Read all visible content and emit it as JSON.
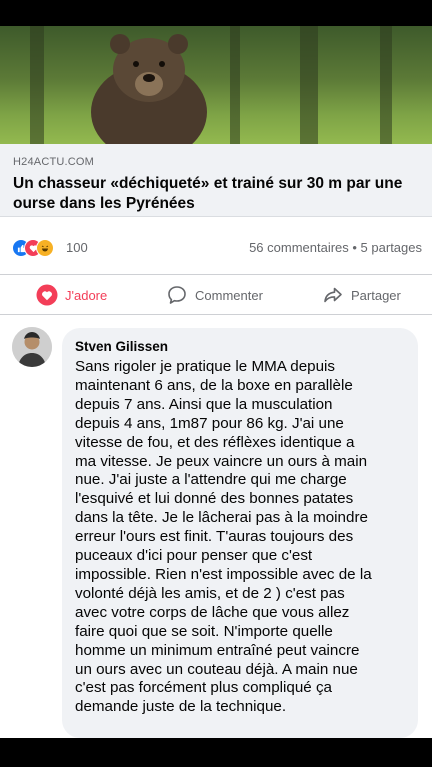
{
  "link_preview": {
    "image_alt_icon": "bear-photo",
    "domain": "H24ACTU.COM",
    "headline": "Un chasseur «déchiqueté» et trainé sur 30 m par une ourse dans les Pyrénées"
  },
  "reactions": {
    "icons": [
      "like-icon",
      "love-icon",
      "haha-icon"
    ],
    "count": "100",
    "comments_shares": "56 commentaires • 5 partages"
  },
  "actions": {
    "love_label": "J'adore",
    "comment_label": "Commenter",
    "share_label": "Partager"
  },
  "comment": {
    "author": "Stven Gilissen",
    "text": "Sans rigoler je pratique le MMA depuis\nmaintenant 6 ans, de la boxe en parallèle\ndepuis 7 ans. Ainsi que la musculation\ndepuis 4 ans, 1m87 pour 86 kg. J'ai une\nvitesse de fou, et des réflèxes identique a\nma vitesse. Je peux vaincre un ours à main\nnue. J'ai juste a l'attendre qui me charge\nl'esquivé et lui donné des bonnes patates\ndans la tête. Je le lâcherai pas à la moindre\nerreur l'ours est finit. T'auras toujours des\npuceaux d'ici pour penser que c'est\nimpossible. Rien n'est impossible avec de la\nvolonté déjà les amis, et de 2 ) c'est pas\navec votre corps de lâche que vous allez\nfaire quoi que se soit. N'importe quelle\nhomme un minimum entraîné peut vaincre\nun ours avec un couteau déjà. A main nue\nc'est pas forcément plus compliqué ça\ndemande juste de la technique."
  },
  "colors": {
    "like": "#1877f2",
    "love": "#f33e58",
    "haha": "#f7b125",
    "secondary_text": "#65676b"
  }
}
